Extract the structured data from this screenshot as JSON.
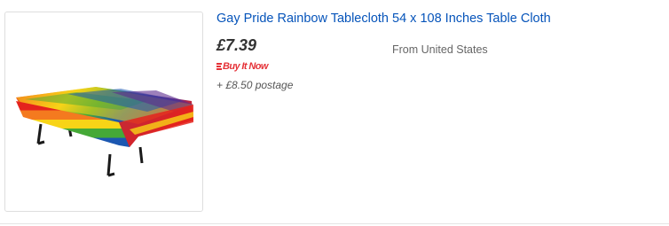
{
  "listing": {
    "title": "Gay Pride Rainbow Tablecloth 54 x 108 Inches Table Cloth",
    "price": "£7.39",
    "buy_format": "Buy It Now",
    "postage": "+ £8.50 postage",
    "location": "From United States",
    "image_name": "rainbow-tablecloth-image"
  },
  "colors": {
    "title_link": "#0654ba",
    "buy_it_now": "#e53238",
    "rainbow": [
      "#e4231d",
      "#f47a1f",
      "#f8d417",
      "#45a937",
      "#1b57b1",
      "#5b2c8e"
    ]
  }
}
